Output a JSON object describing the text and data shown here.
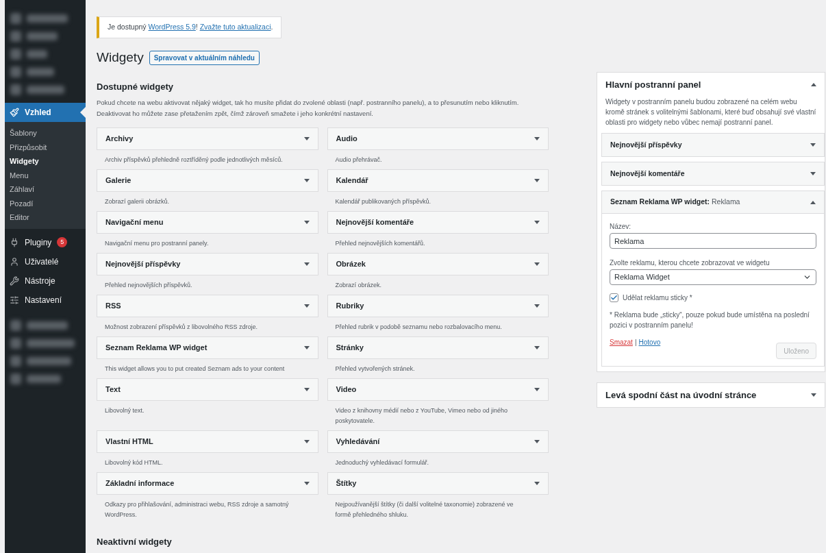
{
  "sidebar": {
    "menu": [
      {
        "label": "Vzhled",
        "selected": true,
        "children": [
          {
            "label": "Šablony",
            "selected": false
          },
          {
            "label": "Přizpůsobit",
            "selected": false
          },
          {
            "label": "Widgety",
            "selected": true
          },
          {
            "label": "Menu",
            "selected": false
          },
          {
            "label": "Záhlaví",
            "selected": false
          },
          {
            "label": "Pozadí",
            "selected": false
          },
          {
            "label": "Editor",
            "selected": false
          }
        ]
      },
      {
        "label": "Pluginy",
        "selected": false,
        "badge": "5"
      },
      {
        "label": "Uživatelé",
        "selected": false
      },
      {
        "label": "Nástroje",
        "selected": false
      },
      {
        "label": "Nastavení",
        "selected": false
      }
    ]
  },
  "notice": {
    "before": "Je dostupný ",
    "link_1": "WordPress 5.9",
    "between": "! ",
    "link_2": "Zvažte tuto aktualizaci",
    "after": "."
  },
  "page_title": "Widgety",
  "header_button": "Spravovat v aktuálním náhledu",
  "available": {
    "title": "Dostupné widgety",
    "description": "Pokud chcete na webu aktivovat nějaký widget, tak ho musíte přidat do zvolené oblasti (např. postranního panelu), a to přesunutím nebo kliknutím. Deaktivovat ho můžete zase přetažením zpět, čímž zároveň smažete i jeho konkrétní nastavení.",
    "widgets": [
      {
        "title": "Archivy",
        "description": "Archiv příspěvků přehledně roztříděný podle jednotlivých měsíců."
      },
      {
        "title": "Audio",
        "description": "Audio přehrávač."
      },
      {
        "title": "Galerie",
        "description": "Zobrazí galerii obrázků."
      },
      {
        "title": "Kalendář",
        "description": "Kalendář publikovaných příspěvků."
      },
      {
        "title": "Navigační menu",
        "description": "Navigační menu pro postranní panely."
      },
      {
        "title": "Nejnovější komentáře",
        "description": "Přehled nejnovějších komentářů."
      },
      {
        "title": "Nejnovější příspěvky",
        "description": "Přehled nejnovějších příspěvků."
      },
      {
        "title": "Obrázek",
        "description": "Zobrazí obrázek."
      },
      {
        "title": "RSS",
        "description": "Možnost zobrazení příspěvků z libovolného RSS zdroje."
      },
      {
        "title": "Rubriky",
        "description": "Přehled rubrik v podobě seznamu nebo rozbalovacího menu."
      },
      {
        "title": "Seznam Reklama WP widget",
        "description": "This widget allows you to put created Seznam ads to your content"
      },
      {
        "title": "Stránky",
        "description": "Přehled vytvořených stránek."
      },
      {
        "title": "Text",
        "description": "Libovolný text."
      },
      {
        "title": "Video",
        "description": "Video z knihovny médií nebo z YouTube, Vimeo nebo od jiného poskytovatele."
      },
      {
        "title": "Vlastní HTML",
        "description": "Libovolný kód HTML."
      },
      {
        "title": "Vyhledávání",
        "description": "Jednoduchý vyhledávací formulář."
      },
      {
        "title": "Základní informace",
        "description": "Odkazy pro přihlašování, administraci webu, RSS zdroje a samotný WordPress."
      },
      {
        "title": "Štítky",
        "description": "Nejpoužívanější štítky (či další volitelné taxonomie) zobrazené ve formě přehledného shluku."
      }
    ]
  },
  "inactive_title": "Neaktivní widgety",
  "areas": [
    {
      "title": "Hlavní postranní panel",
      "expanded": true,
      "description": "Widgety v postranním panelu budou zobrazené na celém webu kromě stránek s volitelnými šablonami, které buď obsahují své vlastní oblasti pro widgety nebo vůbec nemají postranní panel.",
      "widgets": [
        {
          "title": "Nejnovější příspěvky",
          "expanded": false
        },
        {
          "title": "Nejnovější komentáře",
          "expanded": false
        },
        {
          "title": "Seznam Reklama WP widget:",
          "instance": "Reklama",
          "expanded": true,
          "form": {
            "name_label": "Název:",
            "name_value": "Reklama",
            "select_label": "Zvolte reklamu, kterou chcete zobrazovat ve widgetu",
            "select_value": "Reklama Widget",
            "checkbox_label": "Udělat reklamu sticky *",
            "checked": true,
            "note": "* Reklama bude „sticky“, pouze pokud bude umístěna na poslední pozici v postranním panelu!",
            "delete_link": "Smazat",
            "separator": "|",
            "done_link": "Hotovo",
            "save_button": "Uloženo",
            "save_disabled": true
          }
        }
      ]
    },
    {
      "title": "Levá spodní část na úvodní stránce",
      "expanded": false
    }
  ]
}
